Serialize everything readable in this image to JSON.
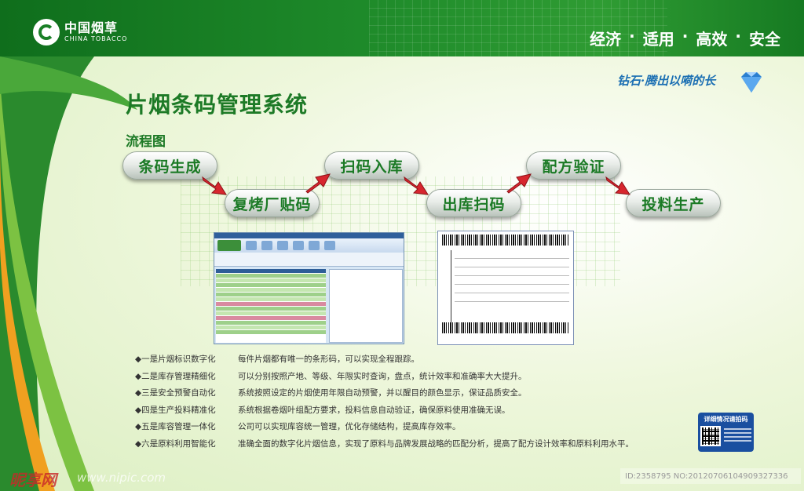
{
  "header": {
    "logo_cn": "中国烟草",
    "logo_en": "CHINA TOBACCO",
    "slogan": [
      "经济",
      "适用",
      "高效",
      "安全"
    ],
    "slogan_sep": "·"
  },
  "brand_slogan": "钻石·腾出以嗬的长",
  "title": "片烟条码管理系统",
  "flow": {
    "heading": "流程图",
    "steps": [
      "条码生成",
      "复烤厂贴码",
      "扫码入库",
      "出库扫码",
      "配方验证",
      "投料生产"
    ]
  },
  "features": [
    {
      "head": "◆一是片烟标识数字化",
      "desc": "每件片烟都有唯一的条形码，可以实现全程跟踪。"
    },
    {
      "head": "◆二是库存管理精细化",
      "desc": "可以分别按照产地、等级、年限实时查询，盘点，统计效率和准确率大大提升。"
    },
    {
      "head": "◆三是安全预警自动化",
      "desc": "系统按照设定的片烟使用年限自动预警，并以醒目的颜色显示，保证品质安全。"
    },
    {
      "head": "◆四是生产投料精准化",
      "desc": "系统根据卷烟叶组配方要求，投料信息自动验证，确保原料使用准确无误。"
    },
    {
      "head": "◆五是库容管理一体化",
      "desc": "公司可以实现库容统一管理，优化存储结构，提高库存效率。"
    },
    {
      "head": "◆六是原料利用智能化",
      "desc": "准确全面的数字化片烟信息，实现了原料与品牌发展战略的匹配分析，提高了配方设计效率和原料利用水平。"
    }
  ],
  "qr": {
    "label": "详细情况请拍码"
  },
  "watermark": {
    "site": "昵享网",
    "url": "www.nipic.com",
    "id": "ID:2358795 NO:20120706104909327336"
  },
  "colors": {
    "brand_green": "#1d7a26",
    "header_green": "#1e8a2a",
    "arrow_red": "#d7262e",
    "qr_blue": "#1a4fa0"
  }
}
